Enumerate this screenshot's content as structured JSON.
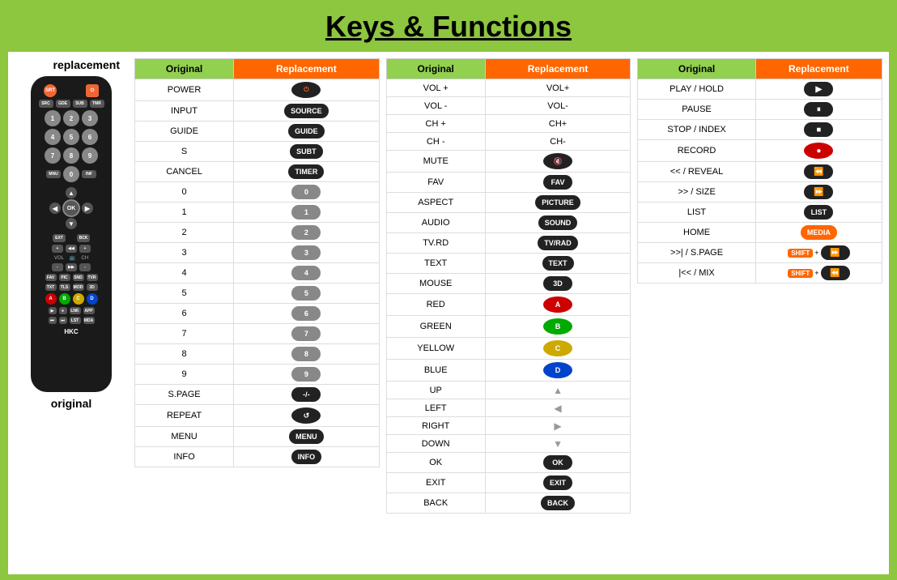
{
  "header": {
    "title": "Keys & Functions"
  },
  "remotes": {
    "replacement_label": "replacement",
    "original_label": "original"
  },
  "table1": {
    "col1": "Original",
    "col2": "Replacement",
    "rows": [
      {
        "original": "POWER",
        "replacement": "power"
      },
      {
        "original": "INPUT",
        "replacement": "SOURCE"
      },
      {
        "original": "GUIDE",
        "replacement": "GUIDE"
      },
      {
        "original": "S",
        "replacement": "SUBT"
      },
      {
        "original": "CANCEL",
        "replacement": "TIMER"
      },
      {
        "original": "0",
        "replacement": "0"
      },
      {
        "original": "1",
        "replacement": "1"
      },
      {
        "original": "2",
        "replacement": "2"
      },
      {
        "original": "3",
        "replacement": "3"
      },
      {
        "original": "4",
        "replacement": "4"
      },
      {
        "original": "5",
        "replacement": "5"
      },
      {
        "original": "6",
        "replacement": "6"
      },
      {
        "original": "7",
        "replacement": "7"
      },
      {
        "original": "8",
        "replacement": "8"
      },
      {
        "original": "9",
        "replacement": "9"
      },
      {
        "original": "S.PAGE",
        "replacement": "-/-"
      },
      {
        "original": "REPEAT",
        "replacement": "repeat"
      },
      {
        "original": "MENU",
        "replacement": "MENU"
      },
      {
        "original": "INFO",
        "replacement": "INFO"
      }
    ]
  },
  "table2": {
    "col1": "Original",
    "col2": "Replacement",
    "rows": [
      {
        "original": "VOL +",
        "replacement": "VOL+"
      },
      {
        "original": "VOL -",
        "replacement": "VOL-"
      },
      {
        "original": "CH +",
        "replacement": "CH+"
      },
      {
        "original": "CH -",
        "replacement": "CH-"
      },
      {
        "original": "MUTE",
        "replacement": "mute"
      },
      {
        "original": "FAV",
        "replacement": "FAV"
      },
      {
        "original": "ASPECT",
        "replacement": "PICTURE"
      },
      {
        "original": "AUDIO",
        "replacement": "SOUND"
      },
      {
        "original": "TV.RD",
        "replacement": "TV/RAD"
      },
      {
        "original": "TEXT",
        "replacement": "TEXT"
      },
      {
        "original": "MOUSE",
        "replacement": "3D"
      },
      {
        "original": "RED",
        "replacement": "A"
      },
      {
        "original": "GREEN",
        "replacement": "B"
      },
      {
        "original": "YELLOW",
        "replacement": "C"
      },
      {
        "original": "BLUE",
        "replacement": "D"
      },
      {
        "original": "UP",
        "replacement": "up"
      },
      {
        "original": "LEFT",
        "replacement": "left"
      },
      {
        "original": "RIGHT",
        "replacement": "right"
      },
      {
        "original": "DOWN",
        "replacement": "down"
      },
      {
        "original": "OK",
        "replacement": "OK"
      },
      {
        "original": "EXIT",
        "replacement": "EXIT"
      },
      {
        "original": "BACK",
        "replacement": "BACK"
      }
    ]
  },
  "table3": {
    "col1": "Original",
    "col2": "Replacement",
    "rows": [
      {
        "original": "PLAY / HOLD",
        "replacement": "play"
      },
      {
        "original": "PAUSE",
        "replacement": "pause"
      },
      {
        "original": "STOP / INDEX",
        "replacement": "stop"
      },
      {
        "original": "RECORD",
        "replacement": "record"
      },
      {
        "original": "<< / REVEAL",
        "replacement": "rew"
      },
      {
        "original": ">> / SIZE",
        "replacement": "fwd"
      },
      {
        "original": "LIST",
        "replacement": "LIST"
      },
      {
        "original": "HOME",
        "replacement": "MEDIA"
      },
      {
        "original": ">>| / S.PAGE",
        "replacement": "shift_fwd"
      },
      {
        "original": "|<< / MIX",
        "replacement": "shift_rew"
      }
    ]
  }
}
